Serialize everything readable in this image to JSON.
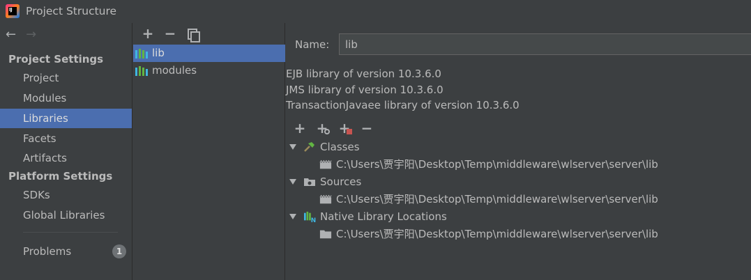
{
  "window": {
    "title": "Project Structure"
  },
  "navigation": {
    "back": "←",
    "forward": "→"
  },
  "sidebar": {
    "project_settings_header": "Project Settings",
    "project_items": [
      {
        "label": "Project",
        "selected": false
      },
      {
        "label": "Modules",
        "selected": false
      },
      {
        "label": "Libraries",
        "selected": true
      },
      {
        "label": "Facets",
        "selected": false
      },
      {
        "label": "Artifacts",
        "selected": false
      }
    ],
    "platform_settings_header": "Platform Settings",
    "platform_items": [
      {
        "label": "SDKs"
      },
      {
        "label": "Global Libraries"
      }
    ],
    "problems": {
      "label": "Problems",
      "count": "1"
    }
  },
  "library_list": {
    "toolbar": {
      "add": "+",
      "remove": "−"
    },
    "items": [
      {
        "label": "lib",
        "selected": true
      },
      {
        "label": "modules",
        "selected": false
      }
    ]
  },
  "detail": {
    "name_label": "Name:",
    "name_value": "lib",
    "descriptions": [
      "EJB library of version 10.3.6.0",
      "JMS library of version 10.3.6.0",
      "TransactionJavaee library of version 10.3.6.0"
    ],
    "toolbar": {
      "add": "+",
      "add_special": "+",
      "add_alt": "+",
      "remove": "−"
    },
    "tree": {
      "classes": {
        "label": "Classes",
        "path": "C:\\Users\\贾宇阳\\Desktop\\Temp\\middleware\\wlserver\\server\\lib"
      },
      "sources": {
        "label": "Sources",
        "path": "C:\\Users\\贾宇阳\\Desktop\\Temp\\middleware\\wlserver\\server\\lib"
      },
      "native": {
        "label": "Native Library Locations",
        "path": "C:\\Users\\贾宇阳\\Desktop\\Temp\\middleware\\wlserver\\server\\lib"
      }
    }
  },
  "colors": {
    "background": "#3c3f41",
    "selection": "#4b6eaf",
    "text": "#bbbbbb",
    "library_icon_green": "#62b543",
    "library_icon_blue": "#40b6e0"
  }
}
